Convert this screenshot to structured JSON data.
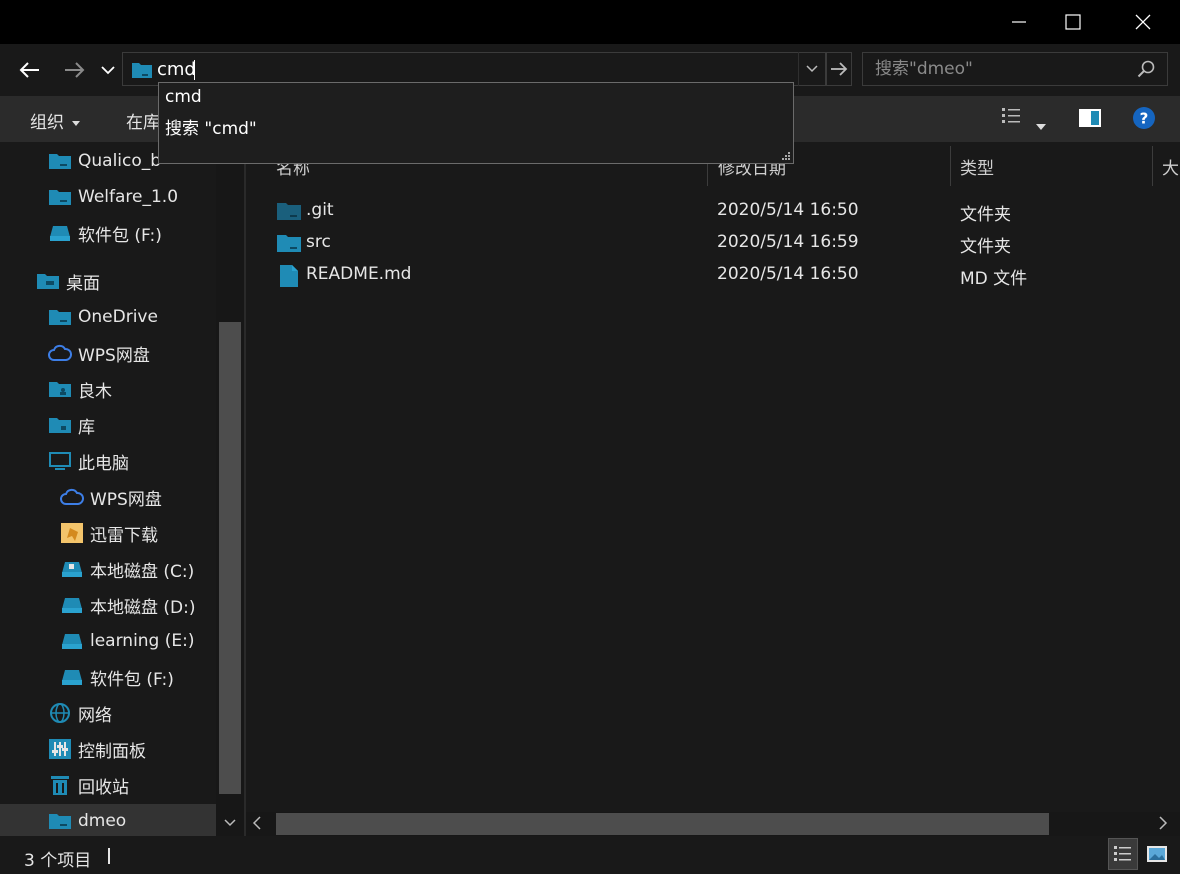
{
  "window": {
    "minimize_icon": "minimize-icon",
    "maximize_icon": "maximize-icon",
    "close_icon": "close-icon"
  },
  "address_bar": {
    "value": "cmd",
    "icon": "folder-icon"
  },
  "search": {
    "placeholder": "搜索\"dmeo\"",
    "icon": "search-icon"
  },
  "autocomplete": {
    "items": [
      {
        "label": "cmd"
      },
      {
        "label": "搜索 \"cmd\""
      }
    ]
  },
  "toolbar": {
    "organize_label": "组织",
    "library_label": "在库"
  },
  "sidebar": {
    "items": [
      {
        "label": "Qualico_b"
      },
      {
        "label": "Welfare_1.0"
      },
      {
        "label": "软件包 (F:)"
      },
      {
        "label": "桌面"
      },
      {
        "label": "OneDrive"
      },
      {
        "label": "WPS网盘"
      },
      {
        "label": "良木"
      },
      {
        "label": "库"
      },
      {
        "label": "此电脑"
      },
      {
        "label": "WPS网盘"
      },
      {
        "label": "迅雷下载"
      },
      {
        "label": "本地磁盘 (C:)"
      },
      {
        "label": "本地磁盘 (D:)"
      },
      {
        "label": "learning (E:)"
      },
      {
        "label": "软件包 (F:)"
      },
      {
        "label": "网络"
      },
      {
        "label": "控制面板"
      },
      {
        "label": "回收站"
      },
      {
        "label": "dmeo"
      }
    ]
  },
  "columns": {
    "name": "名称",
    "date": "修改日期",
    "type": "类型",
    "size": "大"
  },
  "files": [
    {
      "name": ".git",
      "date": "2020/5/14 16:50",
      "type": "文件夹"
    },
    {
      "name": "src",
      "date": "2020/5/14 16:59",
      "type": "文件夹"
    },
    {
      "name": "README.md",
      "date": "2020/5/14 16:50",
      "type": "MD 文件"
    }
  ],
  "status": {
    "item_count": "3 个项目"
  },
  "colors": {
    "folder": "#1f8bb5",
    "background": "#191919",
    "toolbar": "#2b2b2b"
  }
}
